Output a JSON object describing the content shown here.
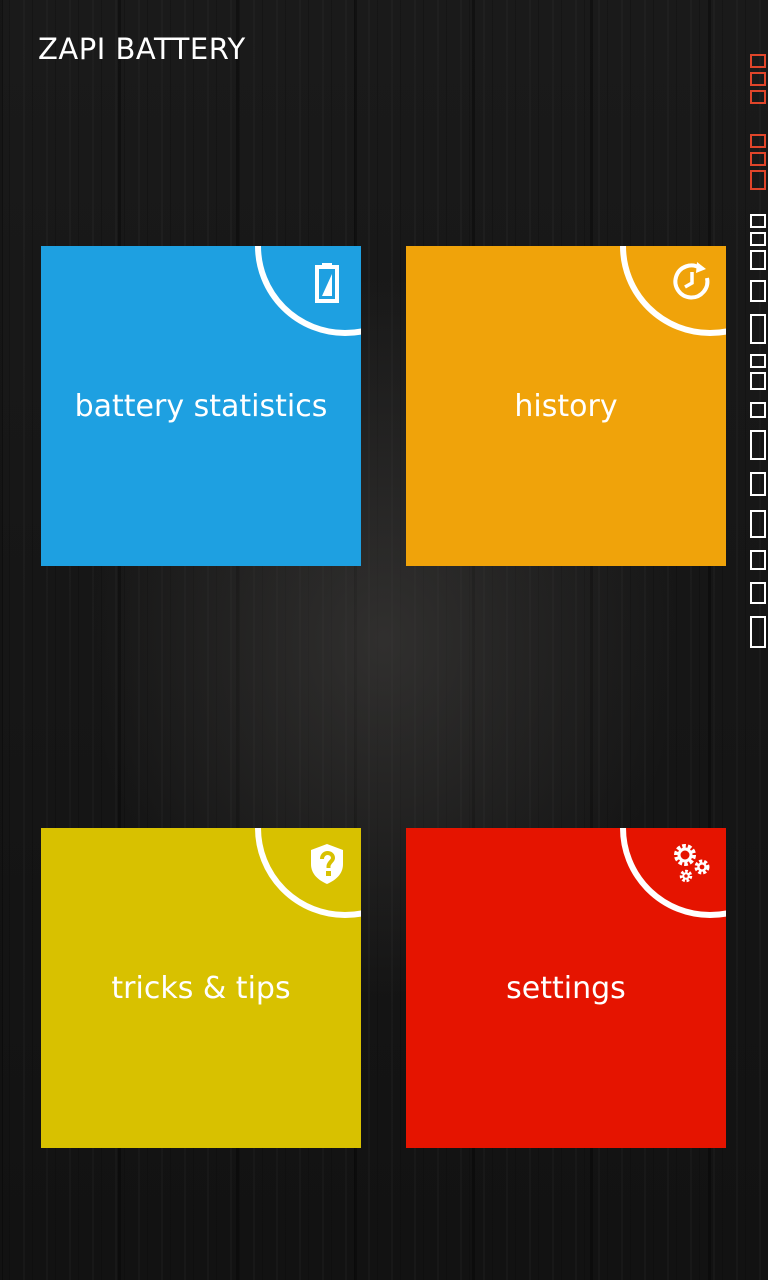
{
  "app": {
    "title": "ZAPI BATTERY"
  },
  "tiles": [
    {
      "id": "battery-statistics",
      "label": "battery statistics",
      "color": "#1ea0e1",
      "icon": "battery-icon"
    },
    {
      "id": "history",
      "label": "history",
      "color": "#f0a30a",
      "icon": "clock-history-icon"
    },
    {
      "id": "tricks-tips",
      "label": "tricks & tips",
      "color": "#d8c100",
      "icon": "shield-question-icon"
    },
    {
      "id": "settings",
      "label": "settings",
      "color": "#e51400",
      "icon": "gears-icon"
    }
  ],
  "colors": {
    "status_strip_accent": "#e0452a",
    "status_strip_primary": "#ffffff"
  }
}
